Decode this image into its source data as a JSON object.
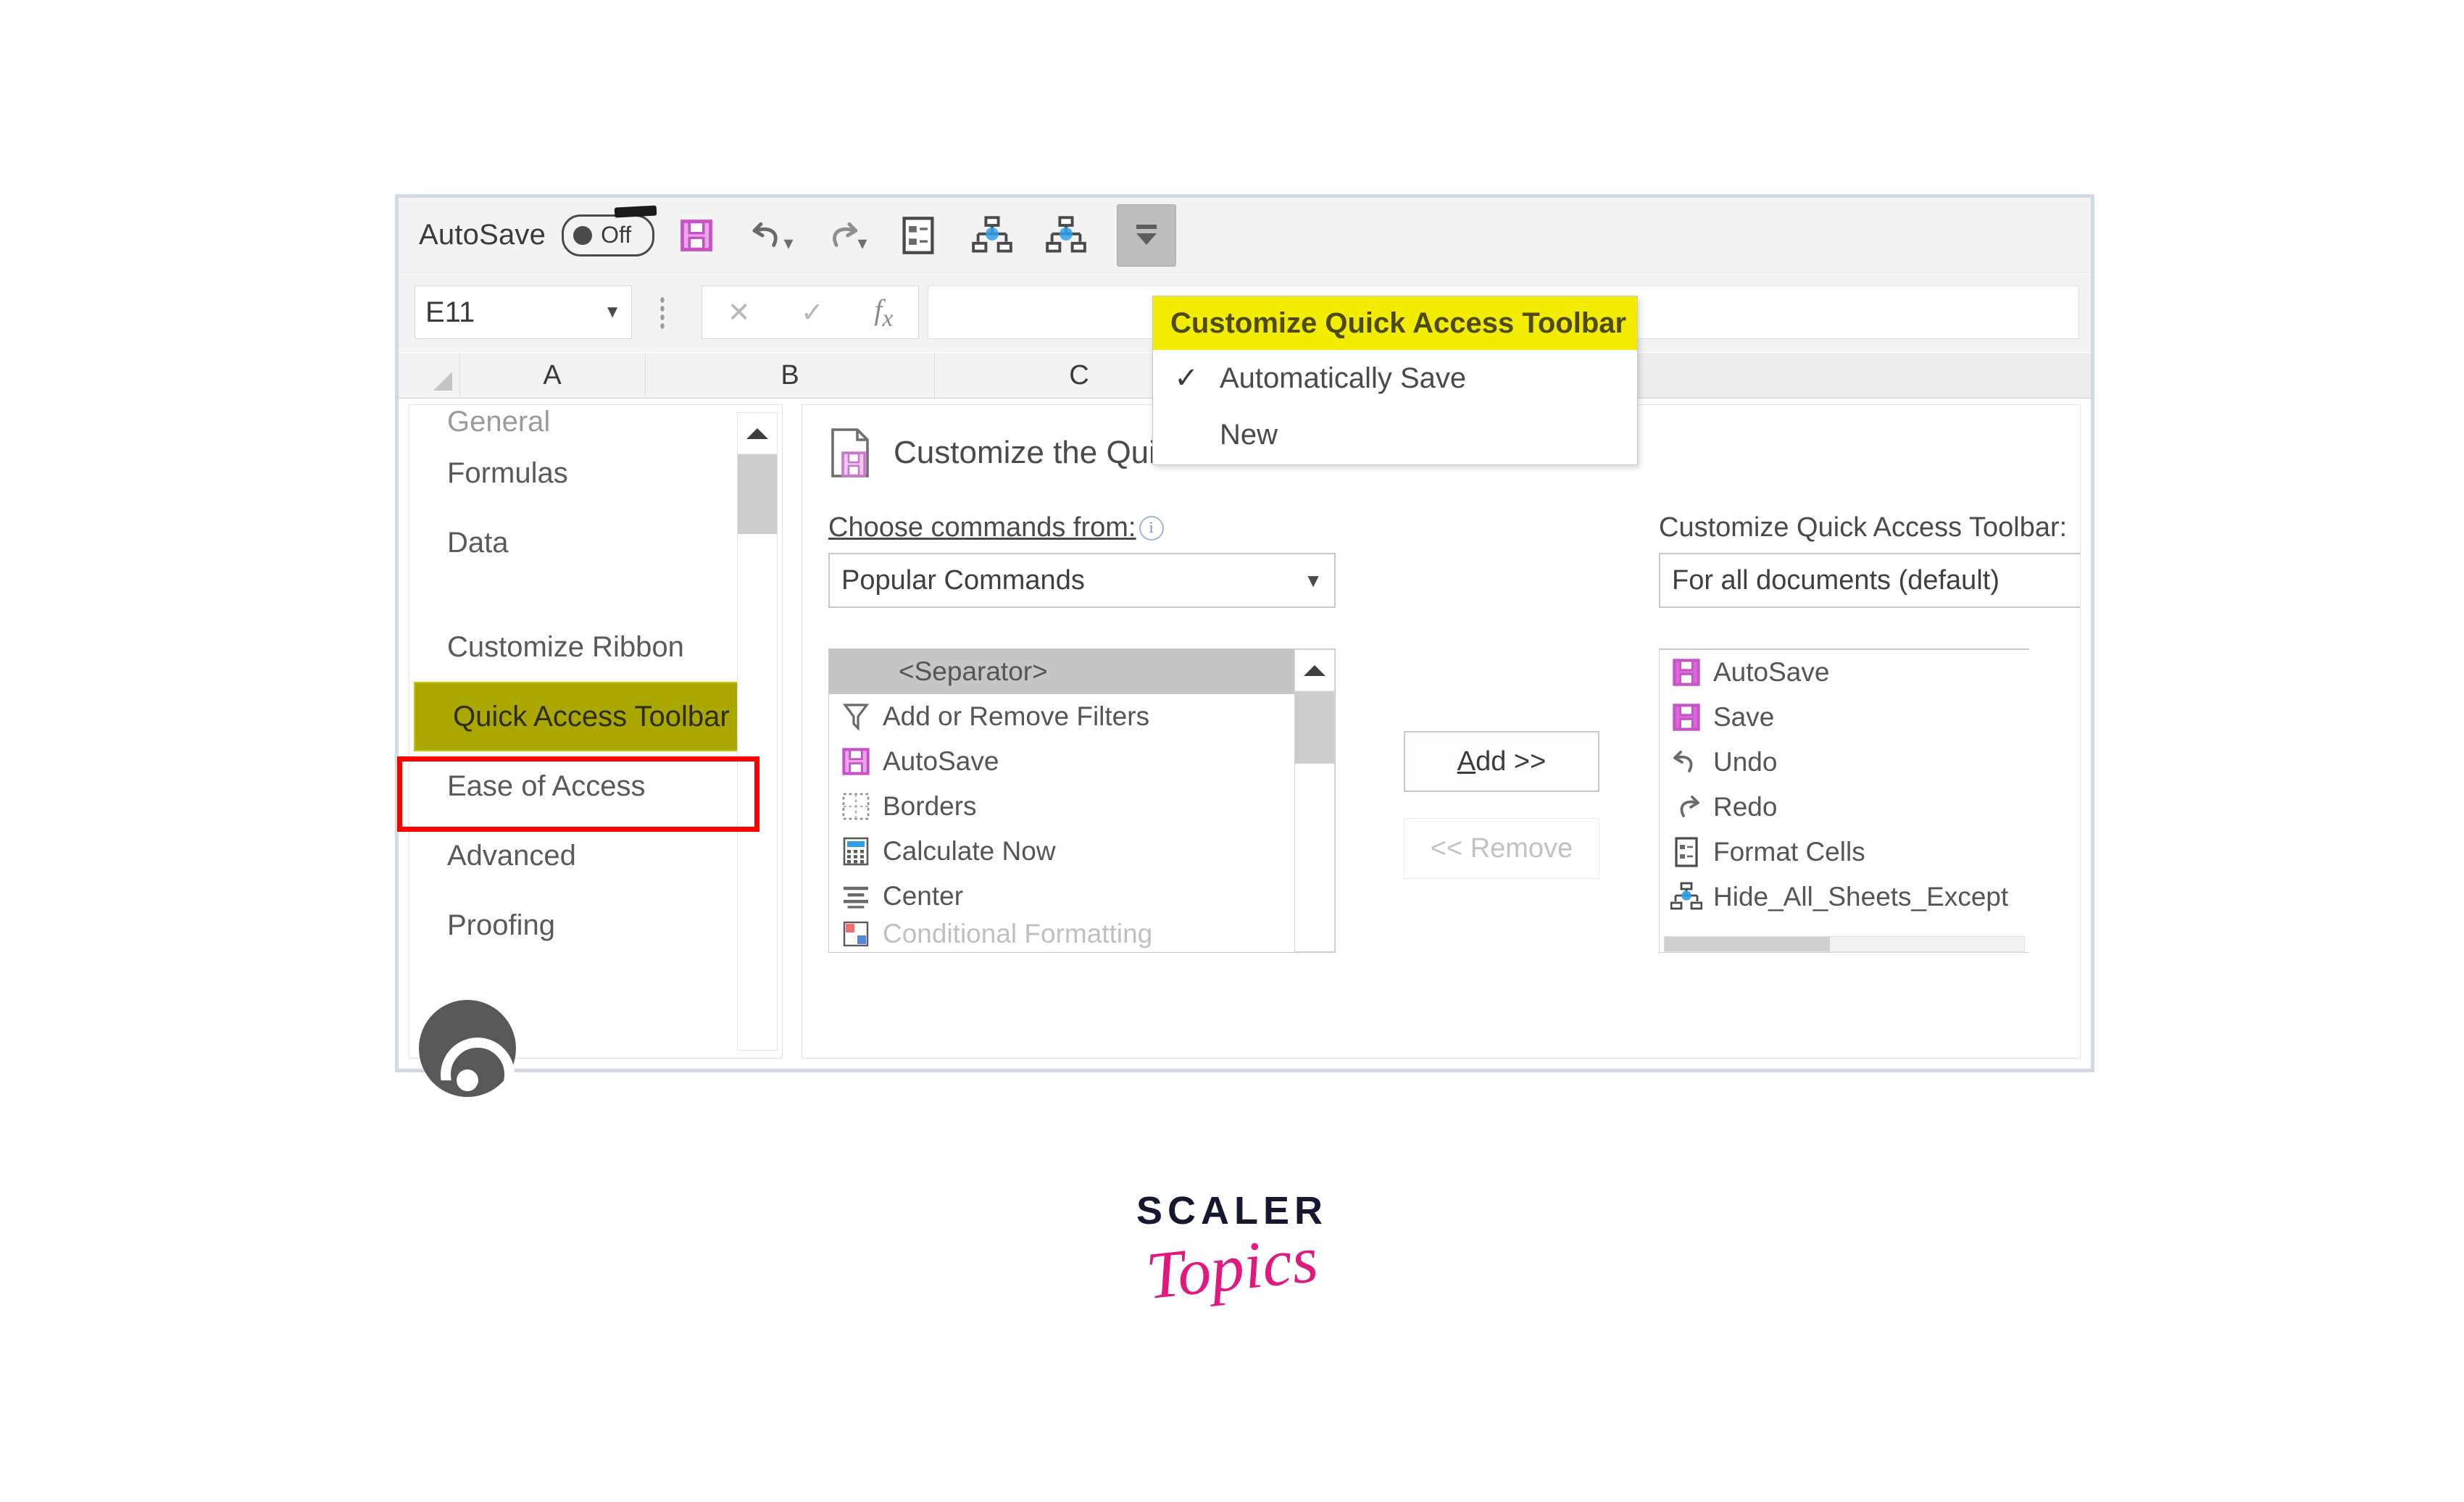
{
  "excel": {
    "qat": {
      "autosave_label": "AutoSave",
      "toggle_state": "Off",
      "buttons": [
        {
          "name": "save-icon",
          "label": "Save"
        },
        {
          "name": "undo-icon",
          "label": "Undo"
        },
        {
          "name": "redo-icon",
          "label": "Redo"
        },
        {
          "name": "format-cells-icon",
          "label": "Format Cells"
        },
        {
          "name": "hide-all-sheets-except-icon",
          "label": "Hide_All_Sheets_Except"
        },
        {
          "name": "hide-all-sheets-except-icon-2",
          "label": "Hide_All_Sheets_Except"
        },
        {
          "name": "customize-qat-dropdown-icon",
          "label": "Customize Quick Access Toolbar"
        }
      ]
    },
    "formula_bar": {
      "name_box_value": "E11",
      "cancel_icon": "close-icon",
      "enter_icon": "check-icon",
      "function_icon": "fx-icon",
      "formula_value": ""
    },
    "columns": [
      "A",
      "B",
      "C"
    ]
  },
  "dropdown": {
    "title": "Customize Quick Access Toolbar",
    "items": [
      {
        "label": "Automatically Save",
        "checked": "✓"
      },
      {
        "label": "New",
        "checked": ""
      }
    ]
  },
  "options_dialog": {
    "nav": {
      "clipped_top": "General",
      "items": [
        {
          "label": "Formulas",
          "selected": false
        },
        {
          "label": "Data",
          "selected": false
        },
        {
          "label": "Customize Ribbon",
          "selected": false
        },
        {
          "label": "Quick Access Toolbar",
          "selected": true
        },
        {
          "label": "Ease of Access",
          "selected": false
        },
        {
          "label": "Advanced",
          "selected": false
        },
        {
          "label": "Proofing",
          "selected": false
        }
      ]
    },
    "pane": {
      "heading": "Customize the Quick Access Toolbar.",
      "heading_icon": "customize-qat-page-icon",
      "left": {
        "label": "Choose commands from:",
        "label_accesskey": "C",
        "info_icon": "info-icon",
        "selected_value": "Popular Commands",
        "commands": [
          {
            "label": "<Separator>",
            "icon": "separator-icon",
            "selected": true,
            "submenu": false
          },
          {
            "label": "Add or Remove Filters",
            "icon": "filter-icon",
            "selected": false,
            "submenu": false
          },
          {
            "label": "AutoSave",
            "icon": "save-icon",
            "selected": false,
            "submenu": false
          },
          {
            "label": "Borders",
            "icon": "borders-icon",
            "selected": false,
            "submenu": true
          },
          {
            "label": "Calculate Now",
            "icon": "calculator-icon",
            "selected": false,
            "submenu": false
          },
          {
            "label": "Center",
            "icon": "align-center-icon",
            "selected": false,
            "submenu": false
          },
          {
            "label": "Conditional Formatting",
            "icon": "conditional-formatting-icon",
            "selected": false,
            "submenu": true
          }
        ]
      },
      "middle": {
        "add_label": "Add >>",
        "add_accesskey": "A",
        "remove_label": "<< Remove",
        "remove_accesskey": "R",
        "remove_disabled": true
      },
      "right": {
        "label": "Customize Quick Access Toolbar:",
        "label_accesskey": "Q",
        "selected_value": "For all documents (default)",
        "commands": [
          {
            "label": "AutoSave",
            "icon": "save-icon"
          },
          {
            "label": "Save",
            "icon": "save-icon"
          },
          {
            "label": "Undo",
            "icon": "undo-icon"
          },
          {
            "label": "Redo",
            "icon": "redo-icon"
          },
          {
            "label": "Format Cells",
            "icon": "format-cells-icon"
          },
          {
            "label": "Hide_All_Sheets_Except",
            "icon": "hide-all-sheets-except-icon"
          }
        ]
      }
    }
  },
  "branding": {
    "name_top": "SCALER",
    "name_bottom": "Topics"
  },
  "colors": {
    "highlight_yellow": "#f2ec00",
    "selected_olive": "#a9a700",
    "annotation_red": "#ff0000",
    "save_magenta": "#c850c8",
    "brand_navy": "#16182f",
    "brand_pink": "#e1197f"
  }
}
